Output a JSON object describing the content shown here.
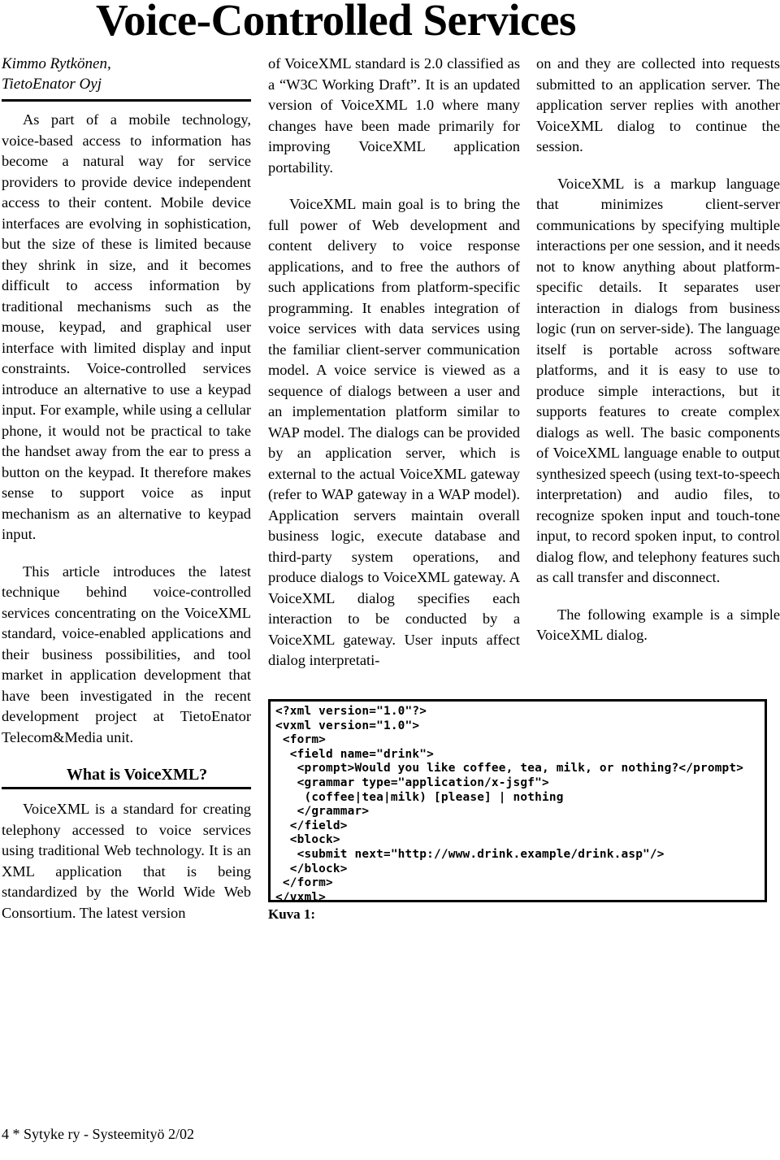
{
  "document": {
    "title": "Voice-Controlled Services",
    "byline": "Kimmo Rytkönen,\nTietoEnator Oyj",
    "footer": "4 * Sytyke ry - Systeemityö 2/02",
    "figure_caption": "Kuva 1:"
  },
  "columns": {
    "left": {
      "paragraphs": [
        "As part of a mobile technology, voice-based access to information has become a natural way for service providers to provide device independent access to their content. Mobile device interfaces are evolving in sophistication, but the size of these is limited because they shrink in size, and it becomes difficult to access information by traditional mechanisms such as the mouse, keypad, and graphical user interface with limited display and input constraints. Voice-controlled services introduce an alternative to use a keypad input. For example, while using a cellular phone, it would not be practical to take the handset away from the ear to press a button on the keypad. It therefore makes sense to support voice as input mechanism as an alternative to keypad input.",
        "This article introduces the latest technique behind voice-controlled services concentrating on the VoiceXML standard, voice-enabled applications and their business possibilities, and tool market in application development that have been investigated in the recent development project at TietoEnator Telecom&Media unit."
      ],
      "section_heading": "What is VoiceXML?",
      "after_heading": "VoiceXML is a standard for creating telephony accessed to voice services using traditional Web technology. It is an XML application that is being standardized by the World Wide Web Consortium. The latest version"
    },
    "middle": {
      "paragraphs": [
        "of VoiceXML standard is 2.0 classified as a “W3C Working Draft”. It is an updated version of VoiceXML 1.0 where many changes have been made primarily for improving VoiceXML application portability.",
        "VoiceXML main goal is to bring the full power of Web development and content delivery to voice response applications, and to free the authors of such applications from platform-specific programming. It enables integration of voice services with data services using the familiar client-server communication model. A voice service is viewed as a sequence of dialogs between a user and an implementation platform similar to WAP model. The dialogs can be provided by an application server, which is external to the actual VoiceXML gateway (refer to WAP gateway in a WAP model). Application servers maintain overall business logic, execute database and third-party system operations, and produce dialogs to VoiceXML gateway. A VoiceXML dialog specifies each interaction to be conducted by a VoiceXML gateway. User inputs affect dialog interpretati-"
      ]
    },
    "right": {
      "paragraphs": [
        "on and they are collected into requests submitted to an application server. The application server replies with another VoiceXML dialog to continue the session.",
        "VoiceXML is a markup language that minimizes client-server communications by specifying multiple interactions per one session, and it needs not to know anything about platform-specific details. It separates user interaction in dialogs from business logic (run on server-side). The language itself is portable across software platforms, and it is easy to use to produce simple interactions, but it supports features to create complex dialogs as well. The basic components of VoiceXML language enable to output synthesized speech (using text-to-speech interpretation) and audio files, to recognize spoken input and touch-tone input, to record spoken input, to control dialog flow, and telephony features such as call transfer and disconnect.",
        "The following example is a simple VoiceXML dialog."
      ]
    }
  },
  "code_listing": {
    "language": "vxml",
    "text": "<?xml version=\"1.0\"?>\n<vxml version=\"1.0\">\n <form>\n  <field name=\"drink\">\n   <prompt>Would you like coffee, tea, milk, or nothing?</prompt>\n   <grammar type=\"application/x-jsgf\">\n    (coffee|tea|milk) [please] | nothing\n   </grammar>\n  </field>\n  <block>\n   <submit next=\"http://www.drink.example/drink.asp\"/>\n  </block>\n </form>\n</vxml>"
  }
}
